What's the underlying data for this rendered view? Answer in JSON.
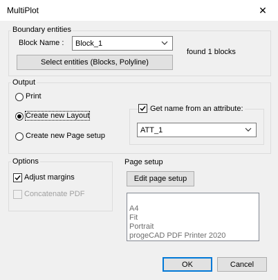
{
  "window": {
    "title": "MultiPlot",
    "close_glyph": "✕"
  },
  "boundary": {
    "legend": "Boundary entities",
    "block_name_label": "Block Name :",
    "block_name_value": "Block_1",
    "found_text": "found 1 blocks",
    "select_button": "Select entities (Blocks, Polyline)"
  },
  "output": {
    "legend": "Output",
    "options": [
      {
        "label": "Print",
        "selected": false
      },
      {
        "label": "Create new Layout",
        "selected": true
      },
      {
        "label": "Create new Page setup",
        "selected": false
      }
    ],
    "attr_checkbox_label": "Get name from an attribute:",
    "attr_checked": true,
    "attr_value": "ATT_1"
  },
  "options": {
    "legend": "Options",
    "adjust_margins": "Adjust margins",
    "adjust_checked": true,
    "concatenate_pdf": "Concatenate PDF",
    "concatenate_checked": false
  },
  "page_setup": {
    "legend": "Page setup",
    "edit_button": "Edit page setup",
    "info": [
      "A4",
      "Fit",
      "Portrait",
      "progeCAD PDF Printer 2020"
    ]
  },
  "footer": {
    "ok": "OK",
    "cancel": "Cancel"
  }
}
